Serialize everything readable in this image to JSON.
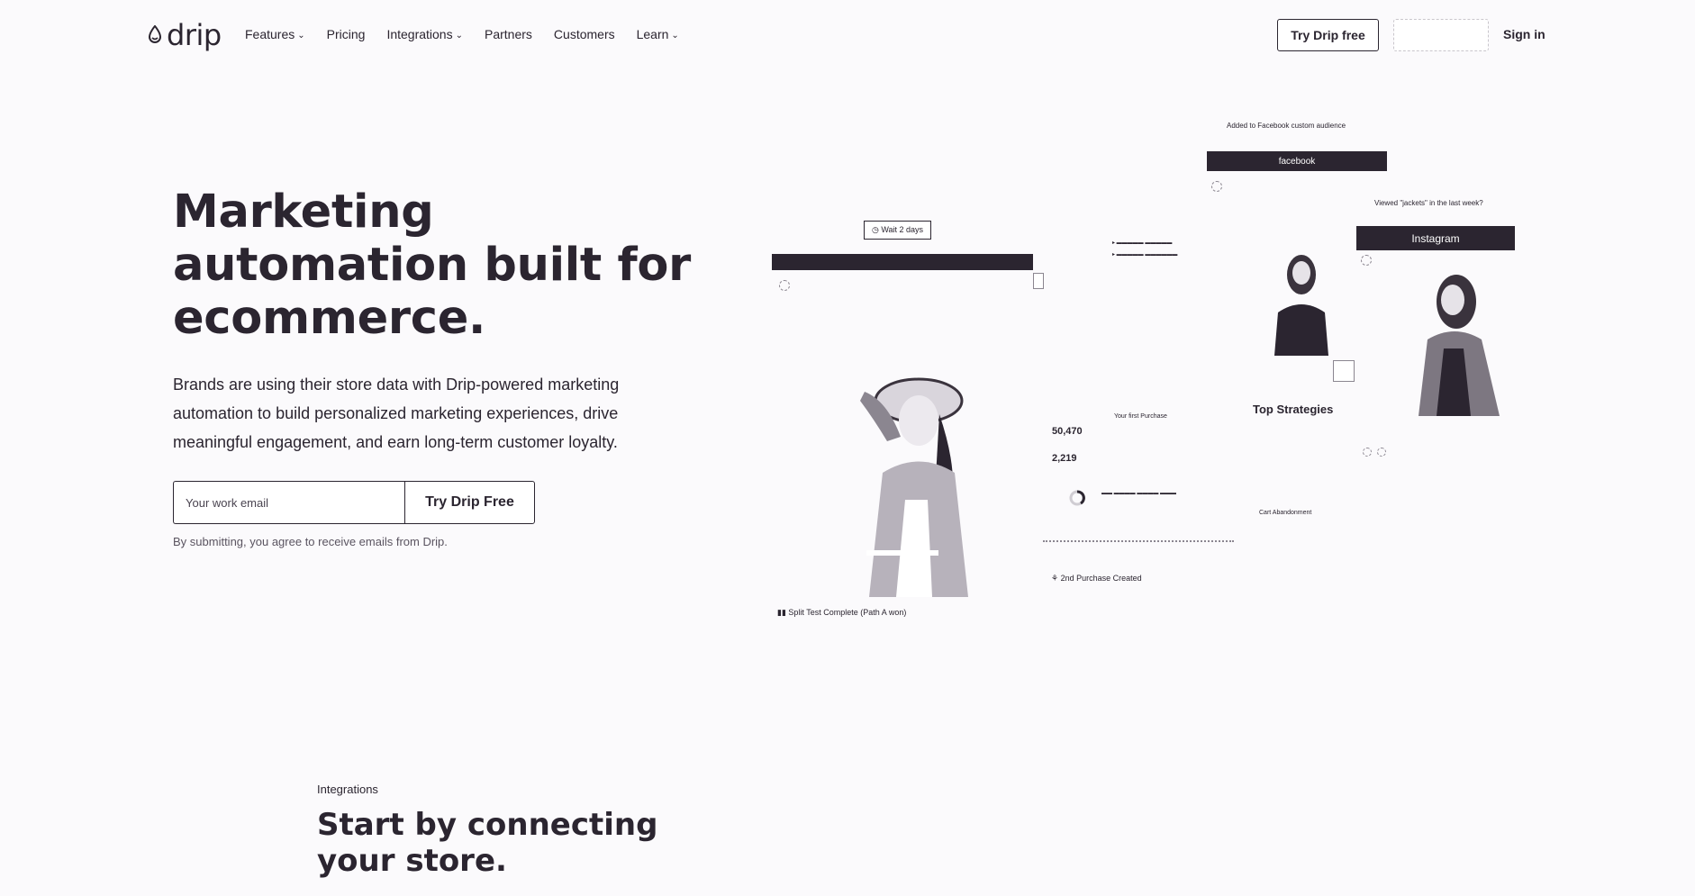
{
  "nav": {
    "logo_text": "drip",
    "links": [
      {
        "label": "Features",
        "has_dropdown": true
      },
      {
        "label": "Pricing",
        "has_dropdown": false
      },
      {
        "label": "Integrations",
        "has_dropdown": true
      },
      {
        "label": "Partners",
        "has_dropdown": false
      },
      {
        "label": "Customers",
        "has_dropdown": false
      },
      {
        "label": "Learn",
        "has_dropdown": true
      }
    ],
    "try_button": "Try Drip free",
    "signin": "Sign in"
  },
  "hero": {
    "title": "Marketing automation built for ecommerce.",
    "subtitle": "Brands are using their store data with Drip-powered marketing automation to build personalized marketing experiences, drive meaningful engagement, and earn long-term customer loyalty.",
    "email_placeholder": "Your work email",
    "submit_label": "Try Drip Free",
    "disclaimer": "By submitting, you agree to receive emails from Drip."
  },
  "illustration": {
    "facebook_caption": "Added to Facebook custom audience",
    "facebook_label": "facebook",
    "instagram_caption": "Viewed \"jackets\" in the last week?",
    "instagram_label": "Instagram",
    "wait_label": "Wait 2 days",
    "top_strategies": "Top Strategies",
    "stat_1": "50,470",
    "stat_2": "2,219",
    "second_purchase": "2nd Purchase Created",
    "split_test": "Split Test Complete (Path A won)",
    "cart_abandonment": "Cart Abandonment"
  },
  "integrations": {
    "eyebrow": "Integrations",
    "title": "Start by connecting your store."
  }
}
